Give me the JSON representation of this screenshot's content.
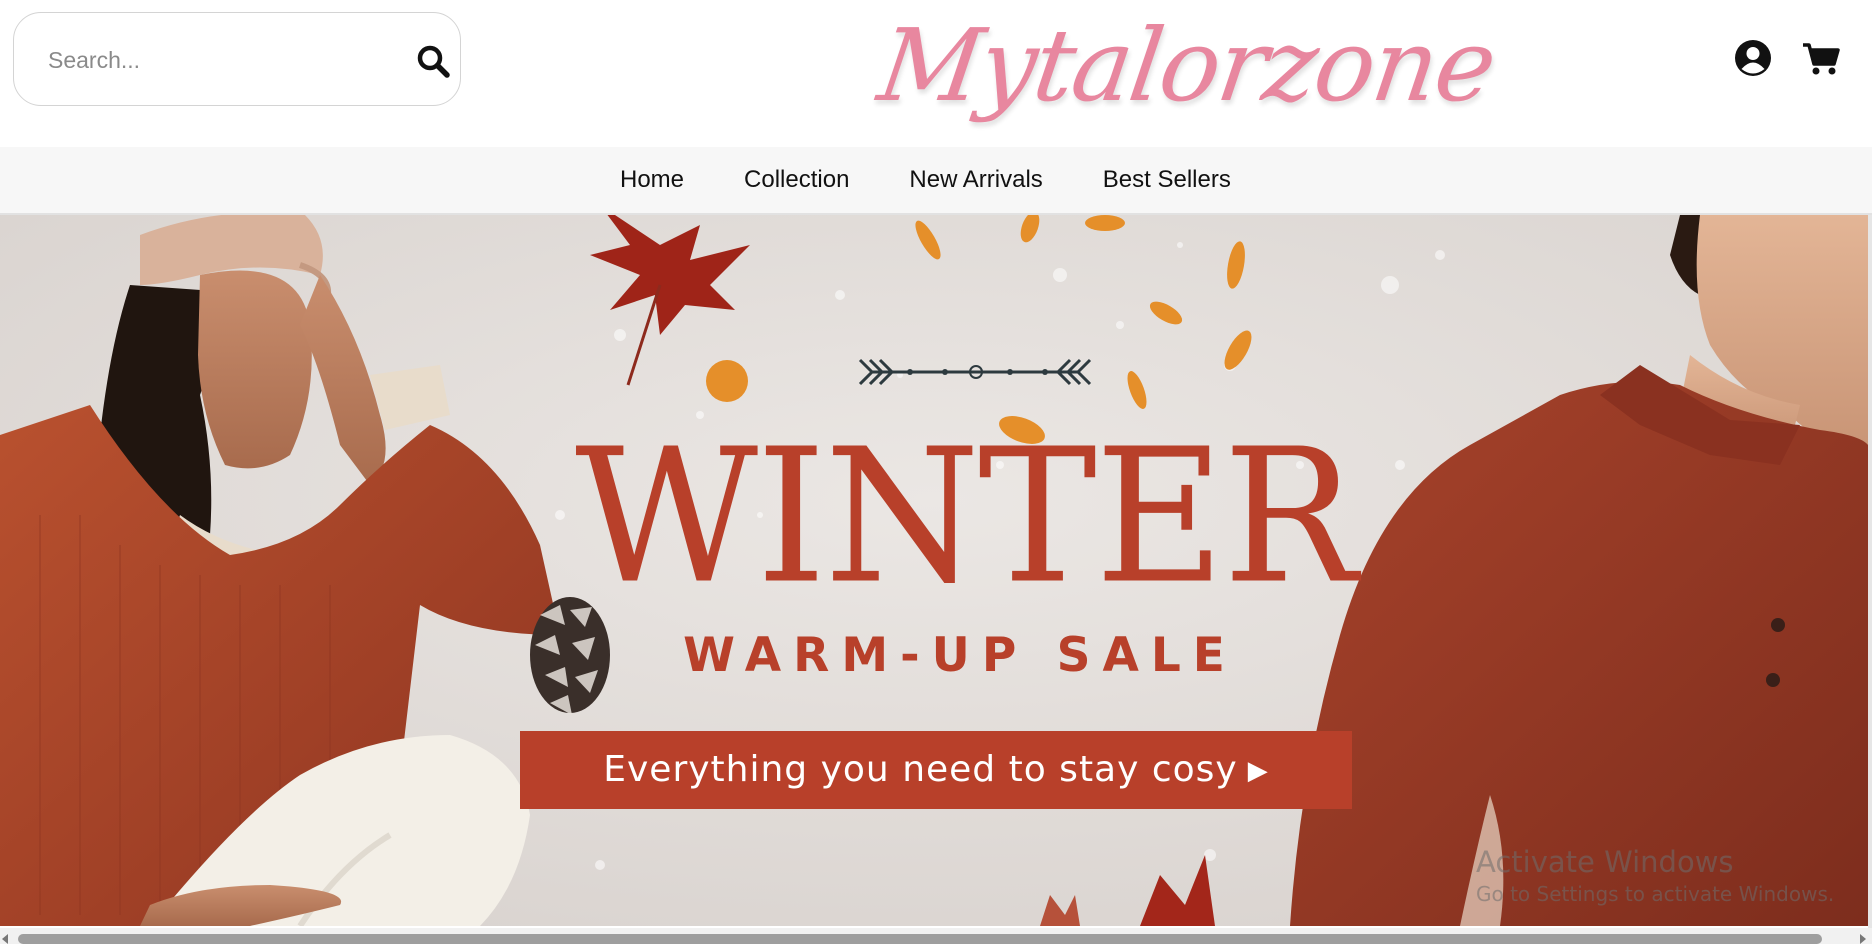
{
  "header": {
    "search": {
      "placeholder": "Search...",
      "value": ""
    },
    "logo": "Mytalorzone",
    "icons": {
      "search": "search-icon",
      "account": "user-circle-icon",
      "cart": "shopping-cart-icon"
    }
  },
  "nav": {
    "items": [
      {
        "label": "Home"
      },
      {
        "label": "Collection"
      },
      {
        "label": "New Arrivals"
      },
      {
        "label": "Best Sellers"
      }
    ]
  },
  "hero": {
    "title": "WINTER",
    "subtitle": "WARM-UP SALE",
    "cta": "Everything you need to stay cosy"
  },
  "watermark": {
    "title": "Activate Windows",
    "subtitle": "Go to Settings to activate Windows."
  },
  "colors": {
    "logo": "#e8879f",
    "accent": "#b8402a",
    "nav_bg": "#f7f7f7",
    "banner_bg": "#e3dedb",
    "sweater": "#a9432c"
  }
}
